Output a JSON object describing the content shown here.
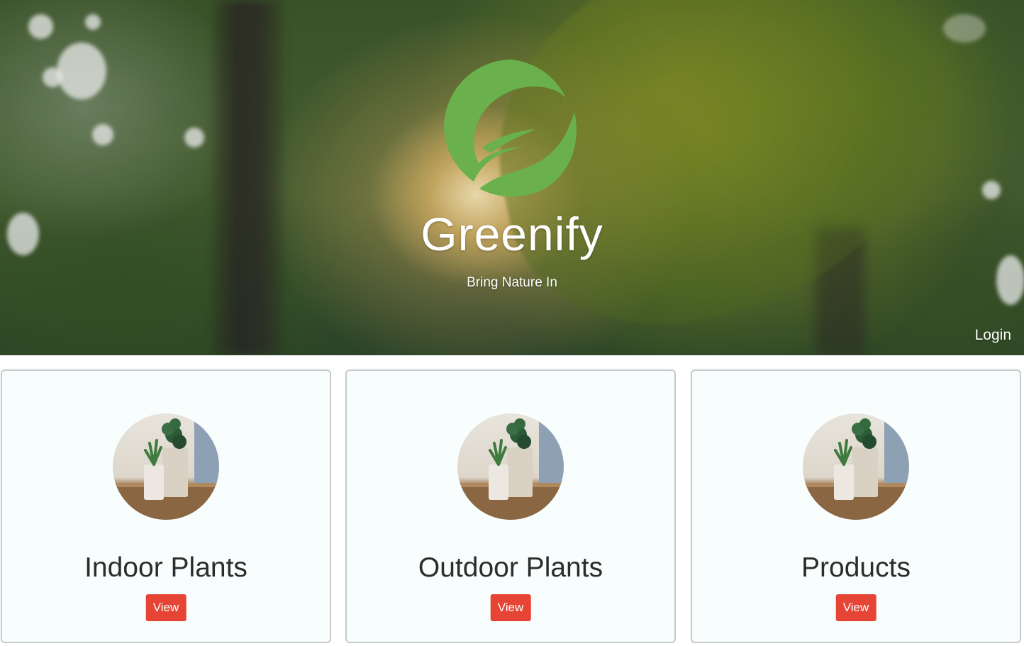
{
  "hero": {
    "title": "Greenify",
    "tagline": "Bring Nature In",
    "login_label": "Login",
    "logo_icon": "leaf-circle-icon",
    "logo_color": "#6ab04c"
  },
  "cards": [
    {
      "title": "Indoor Plants",
      "button_label": "View",
      "image": "potted-plants-image"
    },
    {
      "title": "Outdoor Plants",
      "button_label": "View",
      "image": "potted-plants-image"
    },
    {
      "title": "Products",
      "button_label": "View",
      "image": "potted-plants-image"
    }
  ],
  "colors": {
    "button": "#e64535",
    "card_background": "#f8fdfd",
    "card_border": "#c6cacb",
    "title_text": "#2c2c2c"
  }
}
